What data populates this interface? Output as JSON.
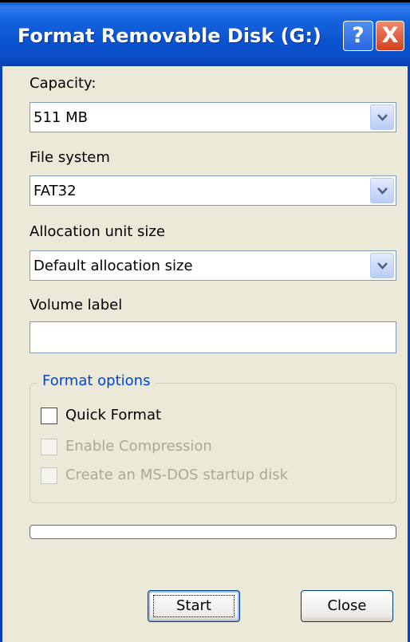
{
  "window": {
    "title": "Format Removable Disk (G:)",
    "help_icon": "question-mark-icon",
    "close_icon": "close-x-icon",
    "help_glyph": "?",
    "close_glyph": "X"
  },
  "capacity": {
    "label": "Capacity:",
    "value": "511 MB"
  },
  "file_system": {
    "label": "File system",
    "value": "FAT32"
  },
  "allocation": {
    "label": "Allocation unit size",
    "value": "Default allocation size"
  },
  "volume": {
    "label": "Volume label",
    "value": ""
  },
  "format_options": {
    "title": "Format options",
    "quick_format": {
      "label": "Quick Format",
      "checked": false,
      "enabled": true
    },
    "enable_compression": {
      "label": "Enable Compression",
      "checked": false,
      "enabled": false
    },
    "msdos_startup": {
      "label": "Create an MS-DOS startup disk",
      "checked": false,
      "enabled": false
    }
  },
  "progress": {
    "value": 0
  },
  "buttons": {
    "start": "Start",
    "close": "Close"
  },
  "colors": {
    "titlebar": "#0a53cf",
    "dialog_bg": "#ece9d8",
    "group_title": "#0046d5",
    "disabled_text": "#aca899",
    "close_button": "#d3411e"
  }
}
